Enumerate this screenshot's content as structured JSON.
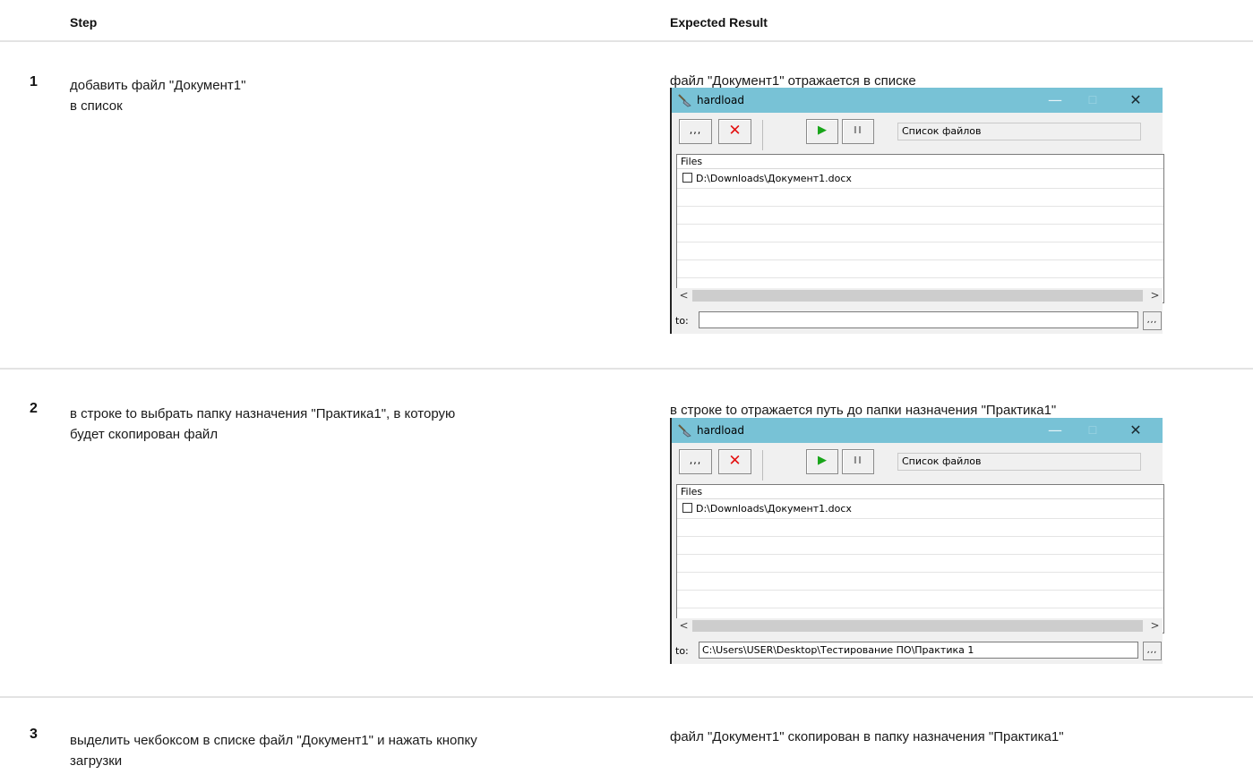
{
  "header": {
    "step_label": "Step",
    "expected_label": "Expected Result"
  },
  "rows": [
    {
      "num": "1",
      "step_line1": "добавить файл \"Документ1\"",
      "step_line2": "в список",
      "expected": "файл \"Документ1\" отражается в списке"
    },
    {
      "num": "2",
      "step_line1": "в строке to выбрать папку назначения \"Практика1\", в которую",
      "step_line2": "будет скопирован файл",
      "expected": "в строке to отражается путь до папки назначения \"Практика1\""
    },
    {
      "num": "3",
      "step_line1": "выделить чекбоксом в списке файл \"Документ1\" и нажать кнопку",
      "step_line2": "загрузки",
      "expected": "файл \"Документ1\" скопирован в папку назначения \"Практика1\""
    }
  ],
  "window": {
    "title": "hardload",
    "minimize_glyph": "—",
    "maximize_glyph": "☐",
    "close_glyph": "✕",
    "browse_label": ",,,",
    "delete_glyph": "✕",
    "play_glyph": "▶",
    "pause_glyph": "II",
    "status_text": "Список файлов",
    "column_files": "Files",
    "file_item": "D:\\Downloads\\Документ1.docx",
    "scroll_left": "<",
    "scroll_right": ">",
    "to_label": "to:",
    "to_browse_label": ",,,"
  },
  "window1": {
    "to_value": ""
  },
  "window2": {
    "to_value": "C:\\Users\\USER\\Desktop\\Тестирование ПО\\Практика 1"
  },
  "colors": {
    "titlebar": "#78c2d6",
    "delete": "#e31010",
    "play": "#19a51a"
  },
  "icons": {
    "app": "shovel-icon",
    "checkbox": "checkbox-icon"
  }
}
